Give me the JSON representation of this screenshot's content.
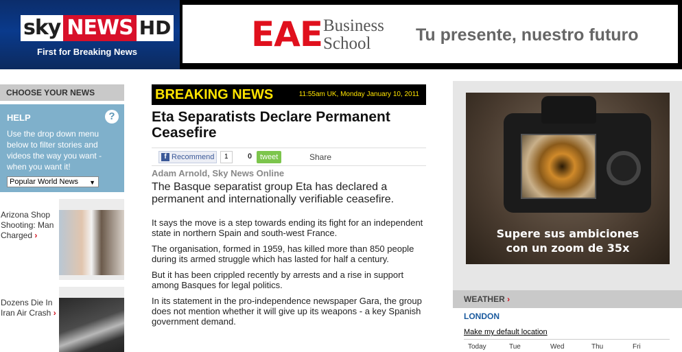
{
  "header": {
    "logo": {
      "sky": "sky",
      "news": "NEWS",
      "hd": "HD"
    },
    "tagline": "First for Breaking News",
    "ad": {
      "brand": "EAE",
      "brand_line1": "Business",
      "brand_line2": "School",
      "slogan": "Tu presente, nuestro futuro"
    }
  },
  "left": {
    "choose_label": "CHOOSE YOUR NEWS",
    "help": {
      "title": "HELP",
      "icon": "?",
      "text": "Use the drop down menu below to filter stories and videos the way you want - when you want it!",
      "select_value": "Popular World News"
    },
    "stories": [
      {
        "title": "Arizona Shop Shooting: Man Charged",
        "arrow": "›"
      },
      {
        "title": "Dozens Die In Iran Air Crash",
        "arrow": "›"
      }
    ]
  },
  "main": {
    "breaking_label": "BREAKING NEWS",
    "timestamp": "11:55am UK, Monday January 10, 2011",
    "headline": "Eta Separatists Declare Permanent Ceasefire",
    "share": {
      "fb_icon": "f",
      "fb_label": "Recommend",
      "fb_count": "1",
      "tweet_count": "0",
      "tweet_label": "tweet",
      "share_label": "Share"
    },
    "byline": "Adam Arnold, Sky News Online",
    "intro": "The Basque separatist group Eta has declared a permanent and internationally verifiable ceasefire.",
    "paragraphs": [
      "It says the move is a step towards ending its fight for an independent state in northern Spain and south-west France.",
      "The organisation, formed in 1959, has killed more than 850 people during its armed struggle which has lasted for half a century.",
      "But it has been crippled recently by arrests and a rise in support among Basques for legal politics.",
      "In its statement in the pro-independence newspaper Gara, the group does not mention whether it will give up its weapons - a key Spanish government demand."
    ]
  },
  "right": {
    "ad": {
      "caption_line1": "Supere sus ambiciones",
      "caption_line2": "con un zoom de 35x"
    },
    "weather": {
      "title": "WEATHER",
      "arrow": "›",
      "city": "LONDON",
      "default_link": "Make my default location",
      "days": [
        "Today",
        "Tue",
        "Wed",
        "Thu",
        "Fri"
      ]
    }
  },
  "colors": {
    "breaking_yellow": "#ffe400",
    "sky_red": "#d8102a",
    "help_blue": "#7fb0cb",
    "link_blue": "#1a5a9e"
  }
}
